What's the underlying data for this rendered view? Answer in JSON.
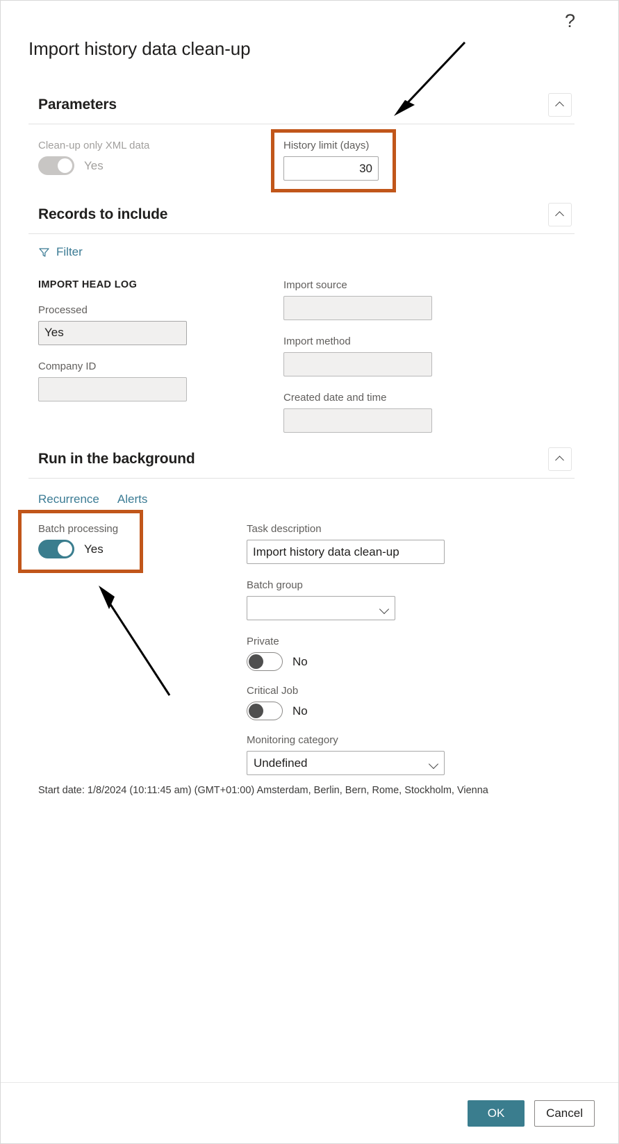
{
  "dialog": {
    "title": "Import history data clean-up",
    "help_icon": "question-mark-icon"
  },
  "sections": {
    "parameters": {
      "title": "Parameters",
      "collapse_icon": "chevron-up-icon",
      "cleanup_xml": {
        "label": "Clean-up only XML data",
        "value": "Yes"
      },
      "history_limit": {
        "label": "History limit (days)",
        "value": "30"
      }
    },
    "records": {
      "title": "Records to include",
      "collapse_icon": "chevron-up-icon",
      "filter_label": "Filter",
      "filter_icon": "funnel-icon",
      "group_label": "IMPORT HEAD LOG",
      "fields_left": [
        {
          "label": "Processed",
          "value": "Yes"
        },
        {
          "label": "Company ID",
          "value": ""
        }
      ],
      "fields_right": [
        {
          "label": "Import source",
          "value": ""
        },
        {
          "label": "Import method",
          "value": ""
        },
        {
          "label": "Created date and time",
          "value": ""
        }
      ]
    },
    "background": {
      "title": "Run in the background",
      "collapse_icon": "chevron-up-icon",
      "tabs": [
        {
          "label": "Recurrence"
        },
        {
          "label": "Alerts"
        }
      ],
      "batch_processing": {
        "label": "Batch processing",
        "value": "Yes"
      },
      "task_description": {
        "label": "Task description",
        "value": "Import history data clean-up"
      },
      "batch_group": {
        "label": "Batch group",
        "value": "",
        "dropdown_icon": "chevron-down-icon"
      },
      "private": {
        "label": "Private",
        "value": "No"
      },
      "critical_job": {
        "label": "Critical Job",
        "value": "No"
      },
      "monitoring_category": {
        "label": "Monitoring category",
        "value": "Undefined",
        "dropdown_icon": "chevron-down-icon"
      },
      "start_date": "Start date: 1/8/2024 (10:11:45 am) (GMT+01:00) Amsterdam, Berlin, Bern, Rome, Stockholm, Vienna"
    }
  },
  "footer": {
    "ok_label": "OK",
    "cancel_label": "Cancel"
  },
  "colors": {
    "accent_teal": "#3a7d8e",
    "link_blue": "#3b7b94",
    "highlight_orange": "#c1561a"
  }
}
